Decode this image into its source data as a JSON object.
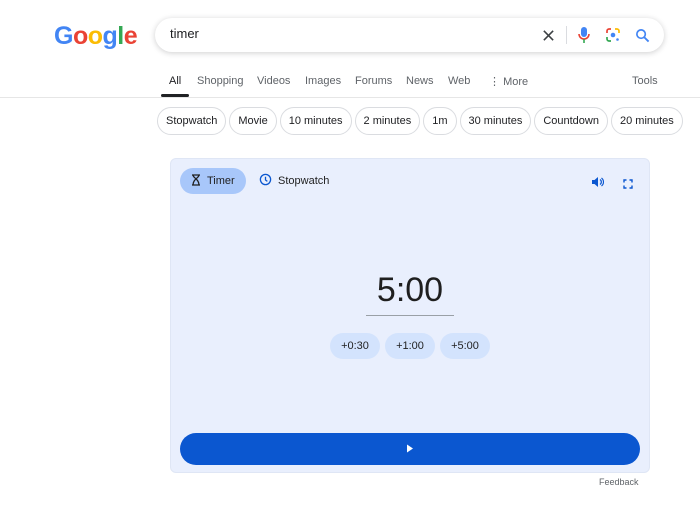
{
  "logo": "Google",
  "search": {
    "query": "timer"
  },
  "tabs": [
    {
      "label": "All"
    },
    {
      "label": "Shopping"
    },
    {
      "label": "Videos"
    },
    {
      "label": "Images"
    },
    {
      "label": "Forums"
    },
    {
      "label": "News"
    },
    {
      "label": "Web"
    },
    {
      "label": "More"
    }
  ],
  "tools": "Tools",
  "chips": [
    "Stopwatch",
    "Movie",
    "10 minutes",
    "2 minutes",
    "1m",
    "30 minutes",
    "Countdown",
    "20 minutes"
  ],
  "timer": {
    "mode_timer": "Timer",
    "mode_stopwatch": "Stopwatch",
    "value": "5:00",
    "adds": [
      "+0:30",
      "+1:00",
      "+5:00"
    ]
  },
  "feedback": "Feedback",
  "colors": {
    "accent": "#0b57d0",
    "card_bg": "#e9effd",
    "selected_chip": "#a8c7fa"
  }
}
